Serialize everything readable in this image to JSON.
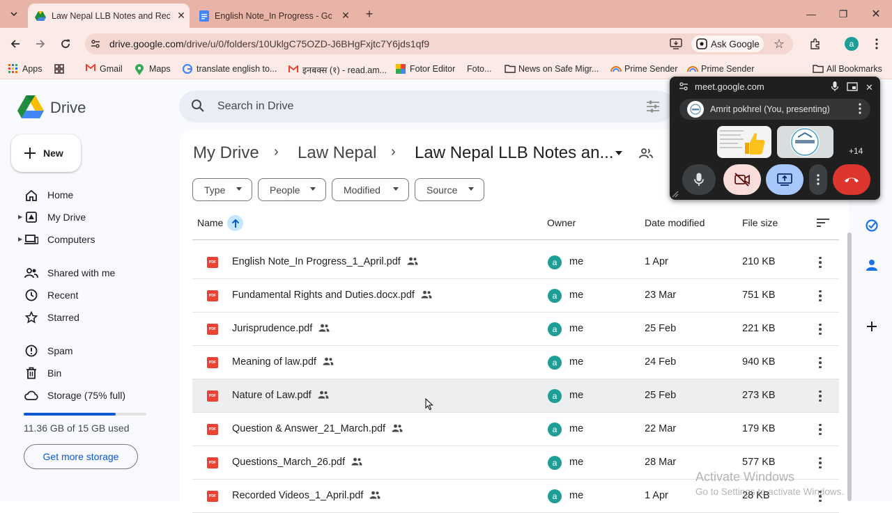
{
  "browser": {
    "tabs": [
      {
        "title": "Law Nepal LLB Notes and Reco",
        "active": true
      },
      {
        "title": "English Note_In Progress - Goo",
        "active": false
      }
    ],
    "url_domain": "drive.google.com",
    "url_path": "/drive/u/0/folders/10UklgC75OZD-J6BHgFxjtc7Y6jds1qf9",
    "ask_google": "Ask Google",
    "profile_initial": "a",
    "bookmarks": [
      {
        "label": "Apps"
      },
      {
        "label": "Gmail"
      },
      {
        "label": "Maps"
      },
      {
        "label": "translate english to..."
      },
      {
        "label": "इनबक्स (१) - read.am..."
      },
      {
        "label": "Fotor Editor"
      },
      {
        "label": "Foto..."
      },
      {
        "label": "News on Safe Migr..."
      },
      {
        "label": "Prime Sender"
      },
      {
        "label": "Prime Sender"
      },
      {
        "label": "All Bookmarks"
      }
    ]
  },
  "drive": {
    "app_name": "Drive",
    "search_placeholder": "Search in Drive",
    "new_label": "New",
    "nav": [
      {
        "label": "Home"
      },
      {
        "label": "My Drive"
      },
      {
        "label": "Computers"
      },
      {
        "label": "Shared with me"
      },
      {
        "label": "Recent"
      },
      {
        "label": "Starred"
      },
      {
        "label": "Spam"
      },
      {
        "label": "Bin"
      },
      {
        "label": "Storage (75% full)"
      }
    ],
    "storage_used": "11.36 GB of 15 GB used",
    "storage_fraction": 0.75,
    "get_storage": "Get more storage",
    "breadcrumb": [
      "My Drive",
      "Law Nepal",
      "Law Nepal LLB Notes an..."
    ],
    "filters": [
      "Type",
      "People",
      "Modified",
      "Source"
    ],
    "columns": {
      "name": "Name",
      "owner": "Owner",
      "date": "Date modified",
      "size": "File size"
    },
    "files": [
      {
        "name": "English Note_In Progress_1_April.pdf",
        "owner": "me",
        "date": "1 Apr",
        "size": "210 KB"
      },
      {
        "name": "Fundamental Rights and Duties.docx.pdf",
        "owner": "me",
        "date": "23 Mar",
        "size": "751 KB"
      },
      {
        "name": "Jurisprudence.pdf",
        "owner": "me",
        "date": "25 Feb",
        "size": "221 KB"
      },
      {
        "name": "Meaning of law.pdf",
        "owner": "me",
        "date": "24 Feb",
        "size": "940 KB"
      },
      {
        "name": "Nature of Law.pdf",
        "owner": "me",
        "date": "25 Feb",
        "size": "273 KB"
      },
      {
        "name": "Question & Answer_21_March.pdf",
        "owner": "me",
        "date": "22 Mar",
        "size": "179 KB"
      },
      {
        "name": "Questions_March_26.pdf",
        "owner": "me",
        "date": "28 Mar",
        "size": "577 KB"
      },
      {
        "name": "Recorded Videos_1_April.pdf",
        "owner": "me",
        "date": "1 Apr",
        "size": "28 KB"
      }
    ],
    "owner_initial": "a"
  },
  "meet": {
    "url": "meet.google.com",
    "presenter": "Amrit pokhrel (You, presenting)",
    "more_count": "+14"
  },
  "watermark": {
    "line1": "Activate Windows",
    "line2": "Go to Settings to activate Windows."
  },
  "colors": {
    "tabstrip": "#e8b4a8",
    "toolbar": "#fbeae6",
    "drive_bg": "#f8fafd",
    "accent": "#0b57d0",
    "pdf_red": "#ea4335",
    "avatar_teal": "#1e9e96",
    "end_call": "#dc362e"
  }
}
